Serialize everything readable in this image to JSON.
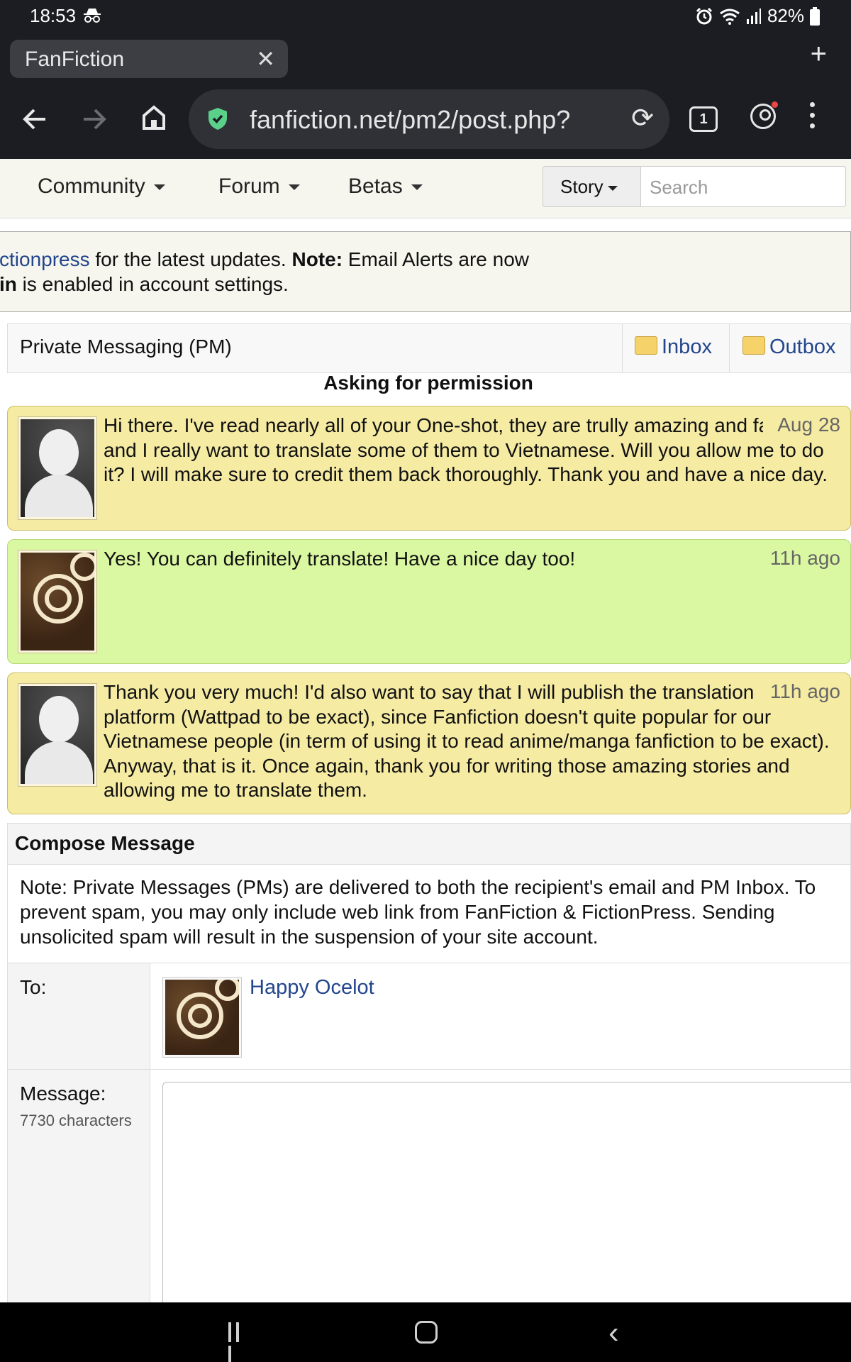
{
  "status_bar": {
    "time": "18:53",
    "battery": "82%"
  },
  "browser": {
    "tab_title": "FanFiction",
    "url": "fanfiction.net/pm2/post.php?",
    "tab_count": "1"
  },
  "site_nav": {
    "items": [
      "Community",
      "Forum",
      "Betas"
    ],
    "search_type": "Story",
    "search_placeholder": "Search"
  },
  "notice": {
    "line1_link": "ctionpress",
    "line1_text": " for the latest updates. ",
    "line1_bold": "Note:",
    "line1_rest": " Email Alerts are now",
    "line2_bold": "in",
    "line2_text": " is enabled in account settings."
  },
  "pm_header": {
    "title": "Private Messaging (PM)",
    "inbox": "Inbox",
    "outbox": "Outbox"
  },
  "subject": "Asking for permission",
  "messages": [
    {
      "text": "Hi there. I've read nearly all of your One-shot, they are trully amazing and fantastic and I really want to translate some of them to Vietnamese. Will you allow me to do it? I will make sure to credit them back thoroughly. Thank you and have a nice day.",
      "date": "Aug 28",
      "avatar": "default-silhouette",
      "color": "#f5eba3"
    },
    {
      "text": "Yes! You can definitely translate! Have a nice day too!",
      "date": "11h ago",
      "avatar": "cinnamon-roll",
      "color": "#daf7a1"
    },
    {
      "text": "Thank you very much! I'd also want to say that I will publish the translation on other platform (Wattpad to be exact), since Fanfiction doesn't quite popular for our Vietnamese people (in term of using it to read anime/manga fanfiction to be exact). Anyway, that is it. Once again, thank you for writing those amazing stories and allowing me to translate them.",
      "date": "11h ago",
      "avatar": "default-silhouette",
      "color": "#f5eba3"
    }
  ],
  "compose": {
    "title": "Compose Message",
    "note": "Note: Private Messages (PMs) are delivered to both the recipient's email and PM Inbox. To prevent spam, you may only include web link from FanFiction & FictionPress. Sending unsolicited spam will result in the suspension of your site account.",
    "to_label": "To:",
    "recipient": "Happy Ocelot",
    "message_label": "Message:",
    "char_count": "7730 characters",
    "message_value": ""
  },
  "colors": {
    "link": "#23468c",
    "chrome_bg": "#1c1d22",
    "shield": "#5bd08a"
  }
}
